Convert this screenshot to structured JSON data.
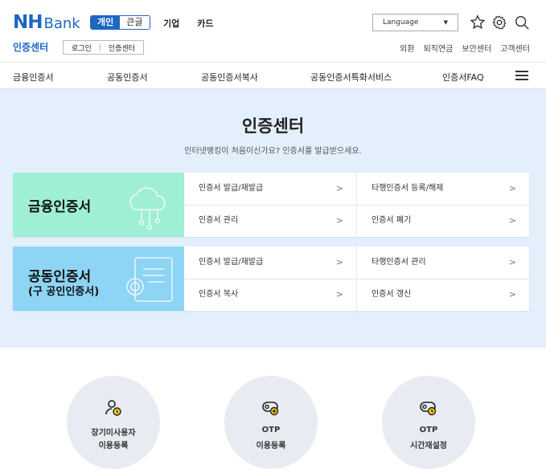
{
  "header": {
    "logo_nh": "NH",
    "logo_bank": "Bank",
    "seg_active": "개인",
    "seg_inactive": "큰글",
    "nav_links": [
      "기업",
      "카드"
    ],
    "language": "Language",
    "section_title": "인증센터",
    "sub_buttons": [
      "로그인",
      "인증센터"
    ],
    "right_links": [
      "외환",
      "퇴직연금",
      "보안센터",
      "고객센터"
    ]
  },
  "nav": {
    "items": [
      "금융인증서",
      "공동인증서",
      "공동인증서복사",
      "공동인증서특화서비스",
      "인증서FAQ"
    ]
  },
  "hero": {
    "title": "인증센터",
    "subtitle": "인터넷뱅킹이 처음이신가요? 인증서를 발급받으세요."
  },
  "cards": [
    {
      "title": "금융인증서",
      "subtitle": "",
      "items": [
        "인증서 발급/재발급",
        "타행인증서 등록/해제",
        "인증서 관리",
        "인증서 폐기"
      ]
    },
    {
      "title": "공동인증서",
      "subtitle": "(구 공인인증서)",
      "items": [
        "인증서 발급/재발급",
        "타행인증서 관리",
        "인증서 복사",
        "인증서 갱신"
      ]
    }
  ],
  "circles": [
    {
      "line1": "장기미사용자",
      "line2": "이용등록",
      "icon": "user-clock-icon"
    },
    {
      "line1": "OTP",
      "line2": "이용등록",
      "icon": "otp-add-icon"
    },
    {
      "line1": "OTP",
      "line2": "시간재설정",
      "icon": "otp-time-icon"
    }
  ],
  "colors": {
    "brand": "#1d66c4",
    "hero_bg": "#e3f0fc",
    "green_card": "#9eefd4",
    "blue_card": "#8ed4f4"
  }
}
